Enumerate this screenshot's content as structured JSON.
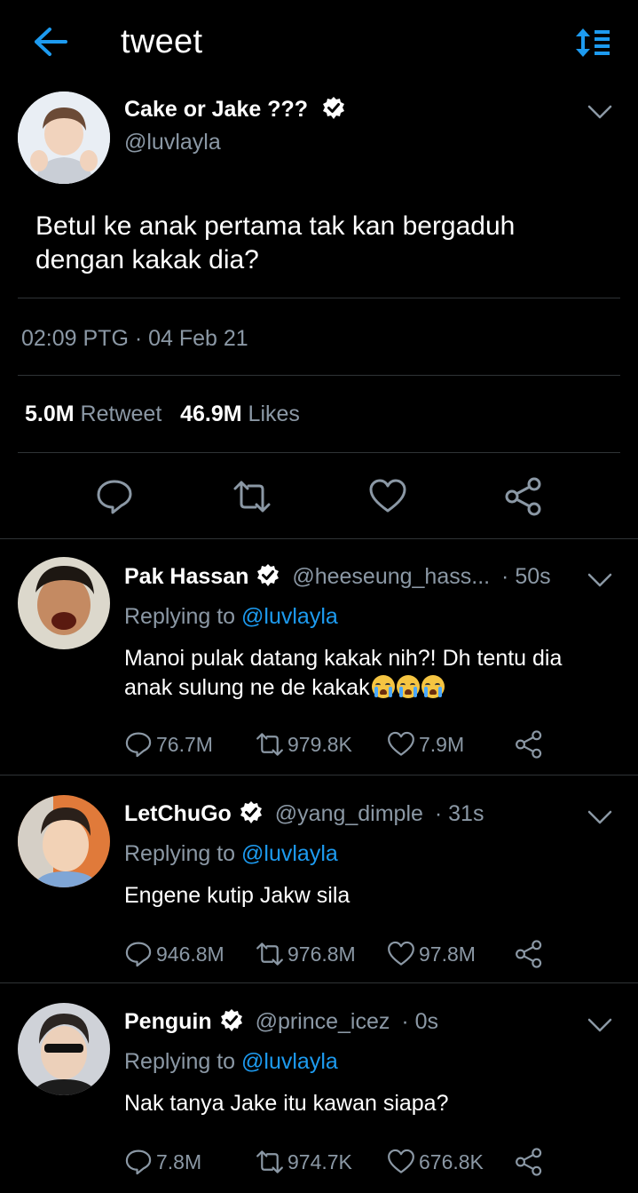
{
  "header": {
    "title": "tweet"
  },
  "tweet": {
    "name": "Cake or Jake ???",
    "handle": "@luvlayla",
    "text_line1": "Betul ke anak pertama tak kan bergaduh",
    "text_line2": "dengan kakak dia?",
    "timestamp": "02:09 PTG · 04 Feb 21",
    "retweets_count": "5.0M",
    "retweets_label": "Retweet",
    "likes_count": "46.9M",
    "likes_label": "Likes"
  },
  "replies": [
    {
      "name": "Pak Hassan",
      "handle": "@heeseung_hass...",
      "time": "· 50s",
      "replying_label": "Replying to",
      "mention": "@luvlayla",
      "text_line1": "Manoi pulak datang kakak nih?! Dh tentu dia",
      "text_line2": "anak sulung ne de kakak",
      "comments": "76.7M",
      "retweets": "979.8K",
      "likes": "7.9M"
    },
    {
      "name": "LetChuGo",
      "handle": "@yang_dimple",
      "time": "· 31s",
      "replying_label": "Replying to",
      "mention": "@luvlayla",
      "text_line1": "Engene kutip Jakw sila",
      "comments": "946.8M",
      "retweets": "976.8M",
      "likes": "97.8M"
    },
    {
      "name": "Penguin",
      "handle": "@prince_icez",
      "time": "· 0s",
      "replying_label": "Replying to",
      "mention": "@luvlayla",
      "text_line1": "Nak tanya Jake itu kawan siapa?",
      "comments": "7.8M",
      "retweets": "974.7K",
      "likes": "676.8K"
    }
  ],
  "colors": {
    "accent": "#1d9bf0",
    "muted": "#8b98a5",
    "divider": "#2f3336"
  },
  "icons": [
    "back-arrow-icon",
    "sort-icon",
    "verified-icon",
    "chevron-down-icon",
    "comment-icon",
    "retweet-icon",
    "like-icon",
    "share-icon",
    "crying-emoji-icon"
  ]
}
